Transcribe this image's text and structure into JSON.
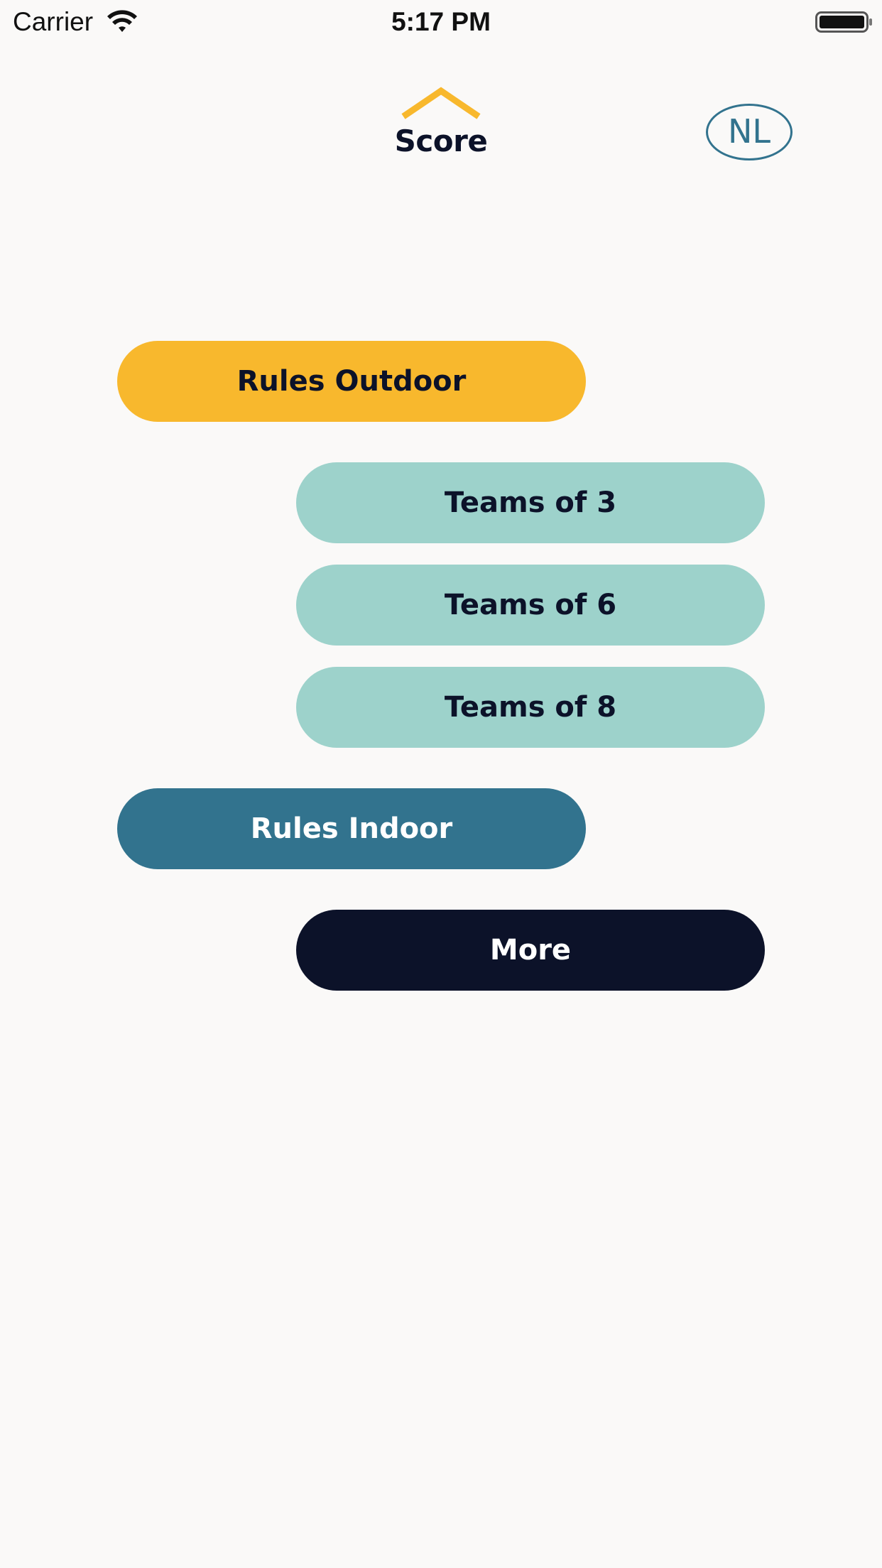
{
  "status_bar": {
    "carrier": "Carrier",
    "time": "5:17 PM"
  },
  "header": {
    "logo_text": "Score",
    "language_button": "NL"
  },
  "menu": {
    "rules_outdoor": "Rules Outdoor",
    "teams_of_3": "Teams of 3",
    "teams_of_6": "Teams of 6",
    "teams_of_8": "Teams of 8",
    "rules_indoor": "Rules Indoor",
    "more": "More"
  },
  "colors": {
    "background": "#faf9f8",
    "accent_yellow": "#f8b82d",
    "teal_light": "#9dd2cb",
    "teal_dark": "#32738e",
    "navy": "#0c1229"
  },
  "icons": {
    "wifi": "wifi-icon",
    "battery": "battery-icon",
    "logo": "roof-chevron-icon"
  }
}
